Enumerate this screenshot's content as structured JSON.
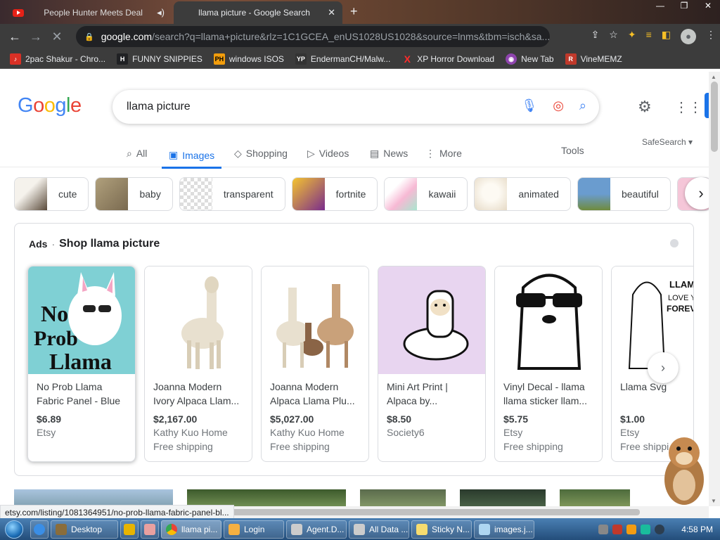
{
  "browser": {
    "tabs": [
      {
        "title": "People Hunter Meets Deal",
        "active": false
      },
      {
        "title": "llama picture - Google Search",
        "active": true
      }
    ],
    "url_host": "google.com",
    "url_path": "/search?q=llama+picture&rlz=1C1GCEA_enUS1028US1028&source=lnms&tbm=isch&sa...",
    "bookmarks": [
      {
        "label": "2pac Shakur - Chro...",
        "color": "#d93025",
        "glyph": "♪"
      },
      {
        "label": "FUNNY SNIPPIES",
        "color": "#202124",
        "glyph": "H"
      },
      {
        "label": "windows ISOS",
        "color": "#f29d0c",
        "glyph": "PH"
      },
      {
        "label": "EndermanCH/Malw...",
        "color": "#333333",
        "glyph": "YP"
      },
      {
        "label": "XP Horror Download",
        "color": "#d93025",
        "glyph": "X"
      },
      {
        "label": "New Tab",
        "color": "#8e44ad",
        "glyph": "◉"
      },
      {
        "label": "VineMEMZ",
        "color": "#c0392b",
        "glyph": "R"
      }
    ]
  },
  "google": {
    "logo": [
      "G",
      "o",
      "o",
      "g",
      "l",
      "e"
    ],
    "query": "llama picture",
    "nav_tabs": [
      {
        "label": "All",
        "icon": "search-icon"
      },
      {
        "label": "Images",
        "icon": "image-icon",
        "active": true
      },
      {
        "label": "Shopping",
        "icon": "tag-icon"
      },
      {
        "label": "Videos",
        "icon": "play-icon"
      },
      {
        "label": "News",
        "icon": "news-icon"
      },
      {
        "label": "More",
        "icon": "more-icon"
      }
    ],
    "tools_label": "Tools",
    "safesearch_label": "SafeSearch ▾",
    "chips": [
      {
        "label": "cute",
        "color": "#8a7a6a"
      },
      {
        "label": "baby",
        "color": "#a09070"
      },
      {
        "label": "transparent",
        "color": "#e0ddd8"
      },
      {
        "label": "fortnite",
        "color": "#e8a12a"
      },
      {
        "label": "kawaii",
        "color": "#f5c6d8"
      },
      {
        "label": "animated",
        "color": "#f4efe6"
      },
      {
        "label": "beautiful",
        "color": "#6a8aa8"
      }
    ],
    "ads": {
      "ads_label": "Ads",
      "separator": "·",
      "title": "Shop llama picture",
      "products": [
        {
          "title": "No Prob Llama Fabric Panel - Blue",
          "price": "$6.89",
          "seller": "Etsy",
          "shipping": "",
          "bg": "#7fd0d4"
        },
        {
          "title": "Joanna Modern Ivory Alpaca Llam...",
          "price": "$2,167.00",
          "seller": "Kathy Kuo Home",
          "shipping": "Free shipping",
          "bg": "#ffffff"
        },
        {
          "title": "Joanna Modern Alpaca Llama Plu...",
          "price": "$5,027.00",
          "seller": "Kathy Kuo Home",
          "shipping": "Free shipping",
          "bg": "#ffffff"
        },
        {
          "title": "Mini Art Print | Alpaca by...",
          "price": "$8.50",
          "seller": "Society6",
          "shipping": "",
          "bg": "#e8d5f0"
        },
        {
          "title": "Vinyl Decal - llama llama sticker llam...",
          "price": "$5.75",
          "seller": "Etsy",
          "shipping": "Free shipping",
          "bg": "#ffffff"
        },
        {
          "title": "Llama Svg",
          "price": "$1.00",
          "seller": "Etsy",
          "shipping": "Free shippi",
          "bg": "#ffffff"
        }
      ]
    },
    "status_url": "etsy.com/listing/1081364951/no-prob-llama-fabric-panel-bl..."
  },
  "taskbar": {
    "items": [
      {
        "label": "Desktop",
        "color": "#8a6d3b"
      },
      {
        "label": "",
        "color": "#e8b400"
      },
      {
        "label": "",
        "color": "#e8a0a0"
      },
      {
        "label": "llama pi...",
        "color": "#4285f4",
        "active": true
      },
      {
        "label": "Login",
        "color": "#f5b041"
      },
      {
        "label": "Agent.D...",
        "color": "#cccccc"
      },
      {
        "label": "All Data ...",
        "color": "#cccccc"
      },
      {
        "label": "Sticky N...",
        "color": "#f7dc6f"
      },
      {
        "label": "images.j...",
        "color": "#aed6f1"
      }
    ],
    "clock": "4:58 PM"
  }
}
